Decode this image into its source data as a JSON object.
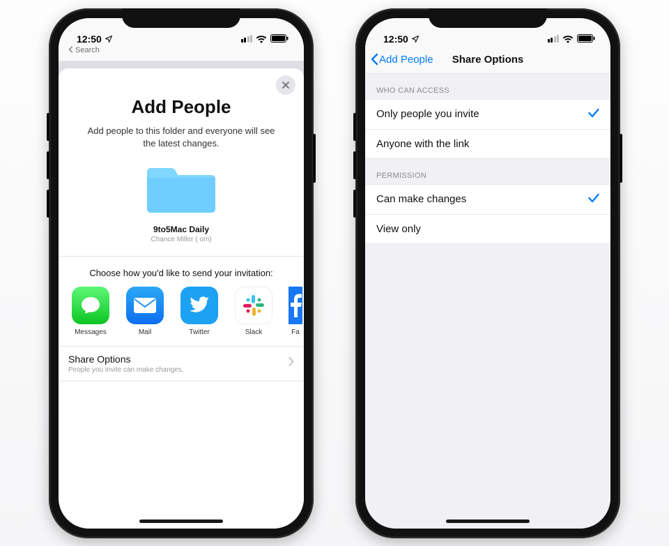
{
  "status": {
    "time": "12:50",
    "breadcrumb_label": "Search"
  },
  "left": {
    "title": "Add People",
    "subtitle": "Add people to this folder and everyone will see the latest changes.",
    "folder_name": "9to5Mac Daily",
    "folder_owner": "Chance Miller (                         om)",
    "choose_text": "Choose how you'd like to send your invitation:",
    "apps": {
      "messages": "Messages",
      "mail": "Mail",
      "twitter": "Twitter",
      "slack": "Slack",
      "facebook": "Fa"
    },
    "share_options_title": "Share Options",
    "share_options_sub": "People you invite can make changes."
  },
  "right": {
    "back_label": "Add People",
    "title": "Share Options",
    "groups": {
      "access": {
        "header": "WHO CAN ACCESS",
        "opt1": "Only people you invite",
        "opt2": "Anyone with the link"
      },
      "permission": {
        "header": "PERMISSION",
        "opt1": "Can make changes",
        "opt2": "View only"
      }
    }
  }
}
